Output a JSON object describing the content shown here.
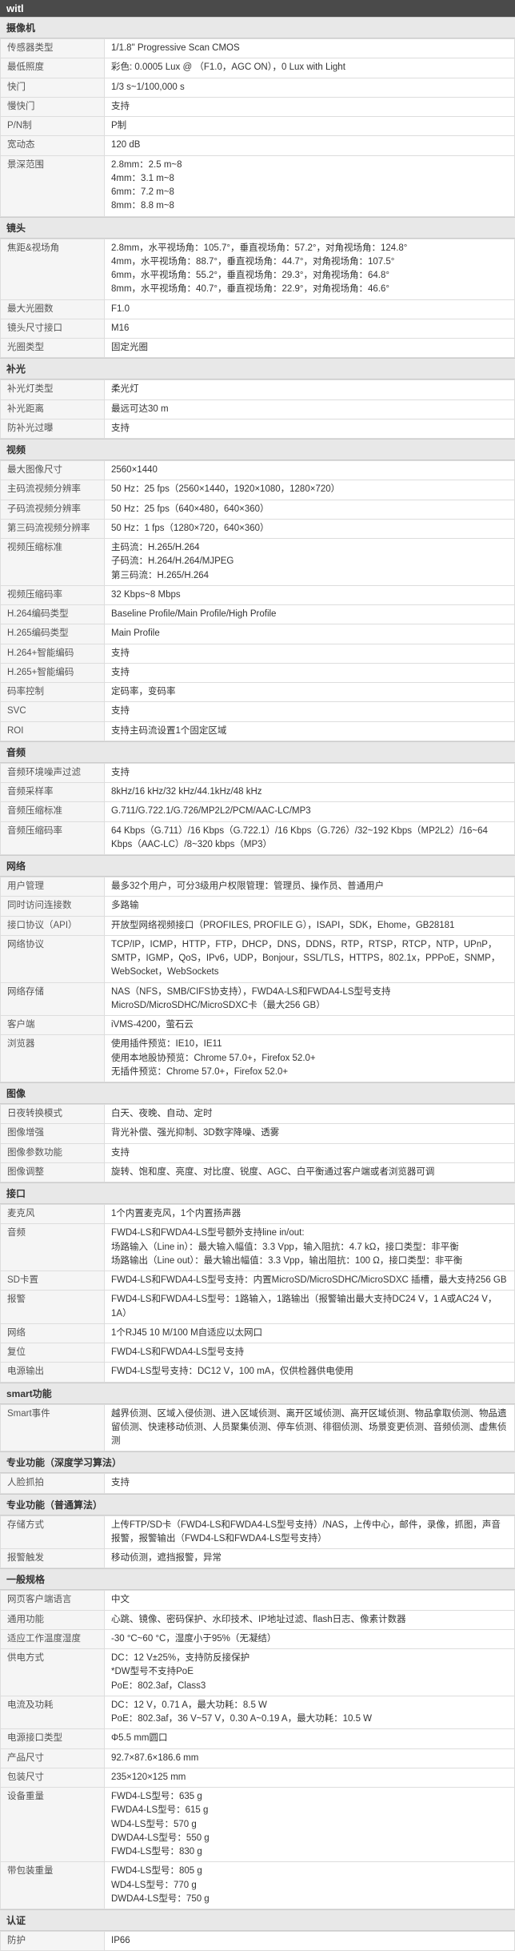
{
  "title": "witl",
  "sections": [
    {
      "name": "摄像机",
      "rows": [
        {
          "label": "传感器类型",
          "value": "1/1.8\" Progressive Scan CMOS"
        },
        {
          "label": "最低照度",
          "value": "彩色: 0.0005 Lux @ （F1.0，AGC ON），0 Lux with Light"
        },
        {
          "label": "快门",
          "value": "1/3 s~1/100,000 s"
        },
        {
          "label": "慢快门",
          "value": "支持"
        },
        {
          "label": "P/N制",
          "value": "P制"
        },
        {
          "label": "宽动态",
          "value": "120 dB"
        },
        {
          "label": "景深范围",
          "value": "2.8mm：2.5 m~8\n4mm：3.1 m~8\n6mm：7.2 m~8\n8mm：8.8 m~8"
        }
      ]
    },
    {
      "name": "镜头",
      "rows": [
        {
          "label": "焦距&视场角",
          "value": "2.8mm，水平视场角：105.7°，垂直视场角：57.2°，对角视场角：124.8°\n4mm，水平视场角：88.7°，垂直视场角：44.7°，对角视场角：107.5°\n6mm，水平视场角：55.2°，垂直视场角：29.3°，对角视场角：64.8°\n8mm，水平视场角：40.7°，垂直视场角：22.9°，对角视场角：46.6°"
        },
        {
          "label": "最大光圈数",
          "value": "F1.0"
        },
        {
          "label": "镜头尺寸接口",
          "value": "M16"
        },
        {
          "label": "光圈类型",
          "value": "固定光圈"
        }
      ]
    },
    {
      "name": "补光",
      "rows": [
        {
          "label": "补光灯类型",
          "value": "柔光灯"
        },
        {
          "label": "补光距离",
          "value": "最远可达30 m"
        },
        {
          "label": "防补光过曝",
          "value": "支持"
        }
      ]
    },
    {
      "name": "视频",
      "rows": [
        {
          "label": "最大图像尺寸",
          "value": "2560×1440"
        },
        {
          "label": "主码流视频分辨率",
          "value": "50 Hz：25 fps（2560×1440，1920×1080，1280×720）"
        },
        {
          "label": "子码流视频分辨率",
          "value": "50 Hz：25 fps（640×480，640×360）"
        },
        {
          "label": "第三码流视频分辨率",
          "value": "50 Hz：1 fps（1280×720，640×360）"
        },
        {
          "label": "视频压缩标准",
          "value": "主码流：H.265/H.264\n子码流：H.264/H.264/MJPEG\n第三码流：H.265/H.264"
        },
        {
          "label": "视频压缩码率",
          "value": "32 Kbps~8 Mbps"
        },
        {
          "label": "H.264编码类型",
          "value": "Baseline Profile/Main Profile/High Profile"
        },
        {
          "label": "H.265编码类型",
          "value": "Main Profile"
        },
        {
          "label": "H.264+智能编码",
          "value": "支持"
        },
        {
          "label": "H.265+智能编码",
          "value": "支持"
        },
        {
          "label": "码率控制",
          "value": "定码率，变码率"
        },
        {
          "label": "SVC",
          "value": "支持"
        },
        {
          "label": "ROI",
          "value": "支持主码流设置1个固定区域"
        }
      ]
    },
    {
      "name": "音频",
      "rows": [
        {
          "label": "音频环境噪声过滤",
          "value": "支持"
        },
        {
          "label": "音频采样率",
          "value": "8kHz/16 kHz/32 kHz/44.1kHz/48 kHz"
        },
        {
          "label": "音频压缩标准",
          "value": "G.711/G.722.1/G.726/MP2L2/PCM/AAC-LC/MP3"
        },
        {
          "label": "音频压缩码率",
          "value": "64 Kbps（G.711）/16 Kbps（G.722.1）/16 Kbps（G.726）/32~192 Kbps（MP2L2）/16~64 Kbps（AAC-LC）/8~320 kbps（MP3）"
        }
      ]
    },
    {
      "name": "网络",
      "rows": [
        {
          "label": "用户管理",
          "value": "最多32个用户，可分3级用户权限管理：管理员、操作员、普通用户"
        },
        {
          "label": "同时访问连接数",
          "value": "多路输"
        },
        {
          "label": "接口协议（API）",
          "value": "开放型网络视频接口（PROFILES, PROFILE G），ISAPI，SDK，Ehome，GB28181"
        },
        {
          "label": "网络协议",
          "value": "TCP/IP，ICMP，HTTP，FTP，DHCP，DNS，DDNS，RTP，RTSP，RTCP，NTP，UPnP，SMTP，IGMP，QoS，IPv6，UDP，Bonjour，SSL/TLS，HTTPS，802.1x，PPPoE，SNMP，WebSocket，WebSockets"
        },
        {
          "label": "网络存储",
          "value": "NAS（NFS，SMB/CIFS协支持），FWD4A-LS和FWDA4-LS型号支持\nMicroSD/MicroSDHC/MicroSDXC卡（最大256 GB）"
        },
        {
          "label": "客户端",
          "value": "iVMS-4200，萤石云"
        },
        {
          "label": "浏览器",
          "value": "使用插件预览：IE10，IE11\n使用本地股协预览：Chrome 57.0+，Firefox 52.0+\n无插件预览：Chrome 57.0+，Firefox 52.0+"
        }
      ]
    },
    {
      "name": "图像",
      "rows": [
        {
          "label": "日夜转换模式",
          "value": "白天、夜晚、自动、定时"
        },
        {
          "label": "图像增强",
          "value": "背光补偿、强光抑制、3D数字降噪、透雾"
        },
        {
          "label": "图像参数功能",
          "value": "支持"
        },
        {
          "label": "图像调整",
          "value": "旋转、饱和度、亮度、对比度、锐度、AGC、白平衡通过客户端或者浏览器可调"
        }
      ]
    },
    {
      "name": "接口",
      "rows": [
        {
          "label": "麦克风",
          "value": "1个内置麦克风，1个内置扬声器"
        },
        {
          "label": "音频",
          "value": "FWD4-LS和FWDA4-LS型号额外支持line in/out:\n场路输入（Line in）：最大输入幅值：3.3 Vpp，输入阻抗：4.7 kΩ，接口类型：非平衡\n场路输出（Line out）：最大输出幅值：3.3 Vpp，输出阻抗：100 Ω，接口类型：非平衡"
        },
        {
          "label": "SD卡置",
          "value": "FWD4-LS和FWDA4-LS型号支持：内置MicroSD/MicroSDHC/MicroSDXC 插槽，最大支持256 GB"
        },
        {
          "label": "报警",
          "value": "FWD4-LS和FWDA4-LS型号：1路输入，1路输出（报警输出最大支持DC24 V，1 A或AC24 V，1A）"
        },
        {
          "label": "网络",
          "value": "1个RJ45 10 M/100 M自适应以太网口"
        },
        {
          "label": "复位",
          "value": "FWD4-LS和FWDA4-LS型号支持"
        },
        {
          "label": "电源输出",
          "value": "FWD4-LS型号支持：DC12 V，100 mA，仅供检器供电使用"
        }
      ]
    },
    {
      "name": "smart功能",
      "rows": [
        {
          "label": "Smart事件",
          "value": "越界侦测、区域入侵侦测、进入区域侦测、离开区域侦测、高开区域侦测、物品拿取侦测、物品遗留侦测、快速移动侦测、人员聚集侦测、停车侦测、徘徊侦测、场景变更侦测、音频侦测、虚焦侦测"
        }
      ]
    },
    {
      "name": "专业功能（深度学习算法）",
      "rows": [
        {
          "label": "人脸抓拍",
          "value": "支持"
        }
      ]
    },
    {
      "name": "专业功能（普通算法）",
      "rows": [
        {
          "label": "存储方式",
          "value": "上传FTP/SD卡（FWD4-LS和FWDA4-LS型号支持）/NAS，上传中心，邮件，录像，抓图，声音报警，报警输出（FWD4-LS和FWDA4-LS型号支持）"
        },
        {
          "label": "报警触发",
          "value": "移动侦测，遮挡报警，异常"
        }
      ]
    },
    {
      "name": "一般规格",
      "rows": [
        {
          "label": "网页客户端语言",
          "value": "中文"
        },
        {
          "label": "通用功能",
          "value": "心跳、镜像、密码保护、水印技术、IP地址过滤、flash日志、像素计数器"
        },
        {
          "label": "适应工作温度湿度",
          "value": "-30 °C~60 °C，湿度小于95%（无凝结）"
        },
        {
          "label": "供电方式",
          "value": "DC：12 V±25%，支持防反接保护\n*DW型号不支持PoE\nPoE：802.3af，Class3"
        },
        {
          "label": "电流及功耗",
          "value": "DC：12 V，0.71 A，最大功耗：8.5 W\nPoE：802.3af，36 V~57 V，0.30 A~0.19 A，最大功耗：10.5 W"
        },
        {
          "label": "电源接口类型",
          "value": "Φ5.5 mm圆口"
        },
        {
          "label": "产品尺寸",
          "value": "92.7×87.6×186.6 mm"
        },
        {
          "label": "包装尺寸",
          "value": "235×120×125 mm"
        },
        {
          "label": "设备重量",
          "value": "FWD4-LS型号：635 g\nFWDA4-LS型号：615 g\nWD4-LS型号：570 g\nDWDA4-LS型号：550 g\nFWD4-LS型号：830 g"
        },
        {
          "label": "带包装重量",
          "value": "FWD4-LS型号：805 g\nWD4-LS型号：770 g\nDWDA4-LS型号：750 g"
        }
      ]
    },
    {
      "name": "认证",
      "rows": [
        {
          "label": "防护",
          "value": "IP66"
        }
      ]
    }
  ]
}
